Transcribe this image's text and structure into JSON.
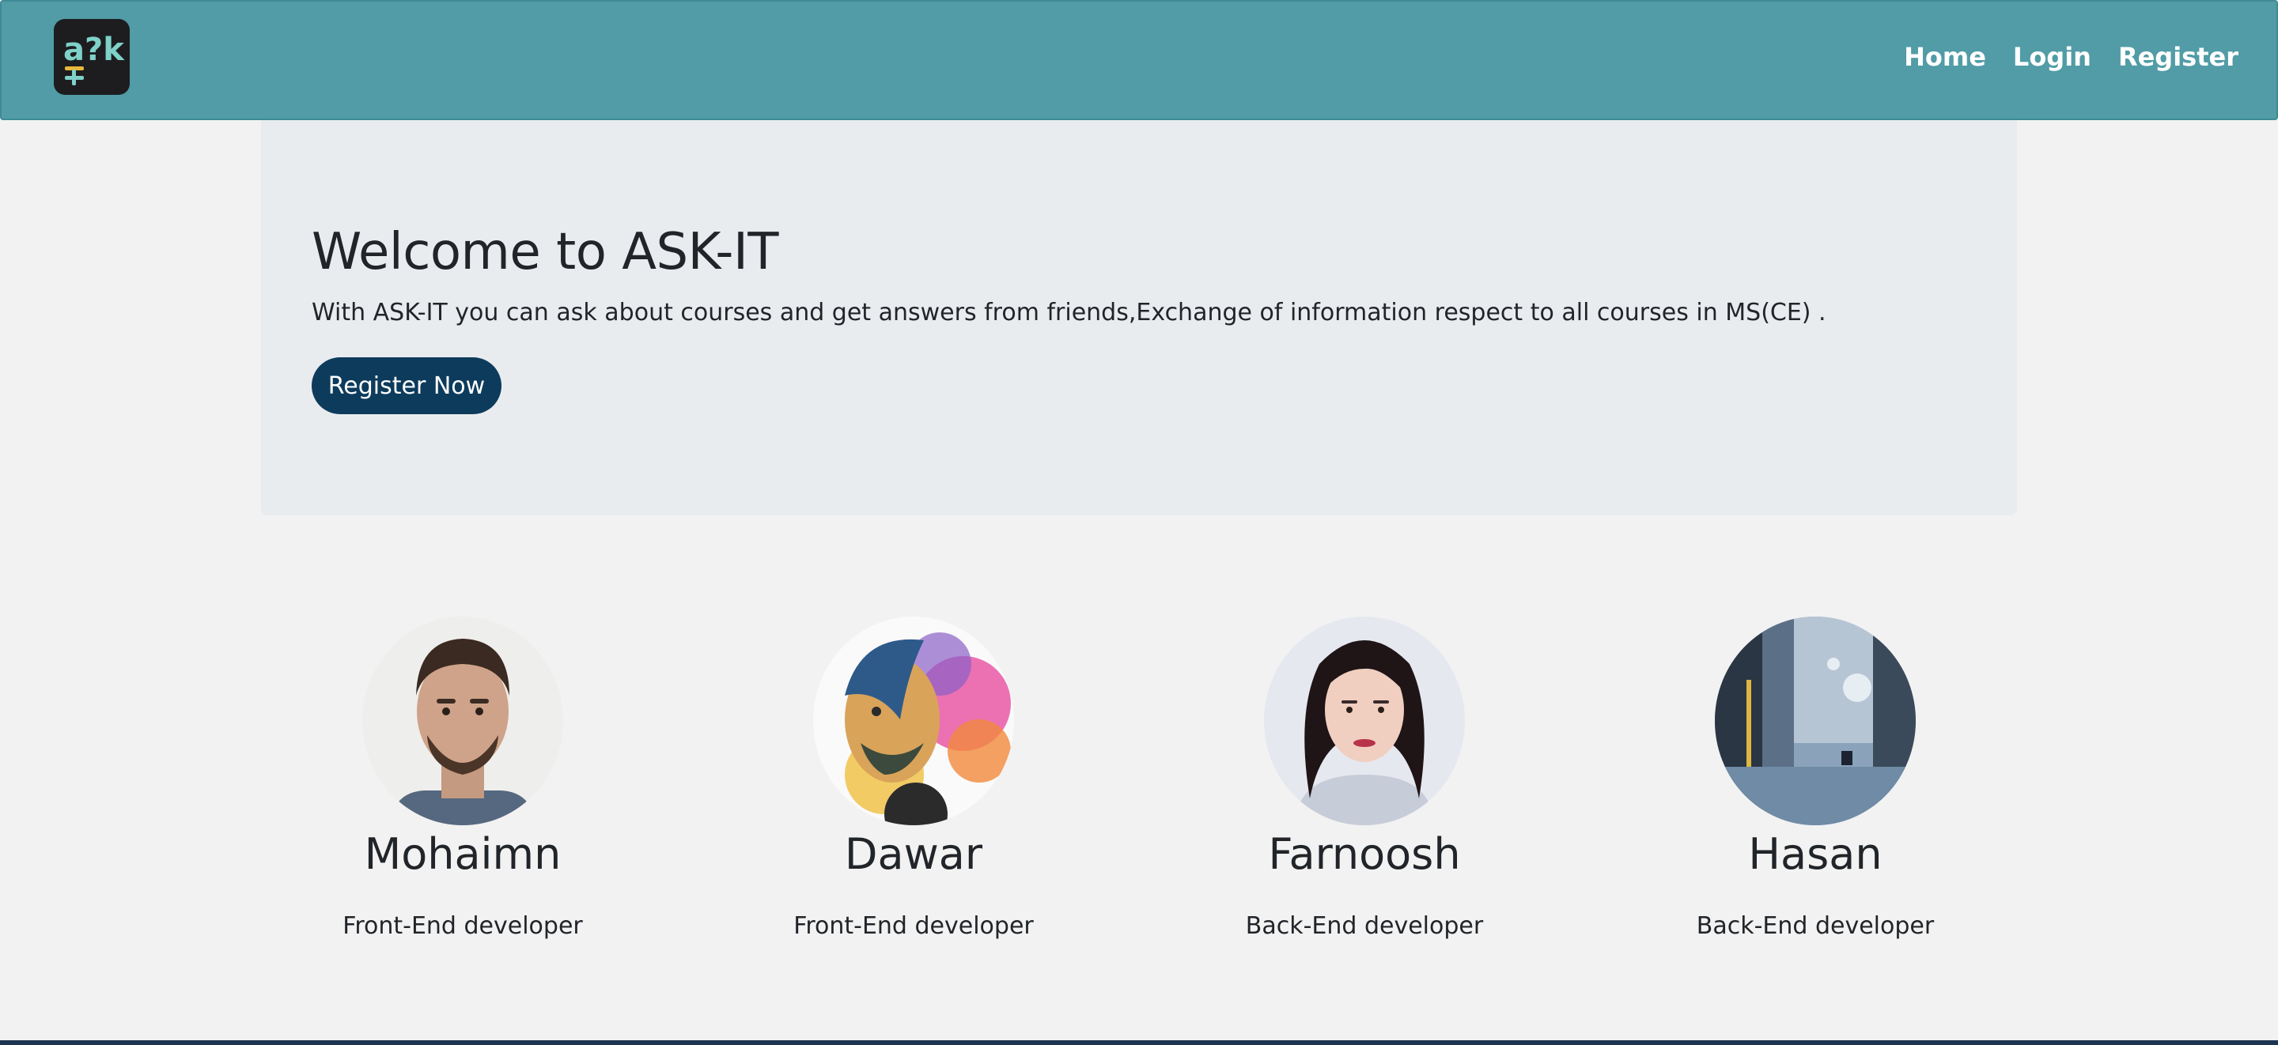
{
  "nav": {
    "logo_text": "a?k",
    "links": [
      "Home",
      "Login",
      "Register"
    ]
  },
  "hero": {
    "title": "Welcome to ASK-IT",
    "text": "With ASK-IT you can ask about courses and get answers from friends,Exchange of information respect to all courses in MS(CE) .",
    "button_label": "Register Now"
  },
  "team": [
    {
      "name": "Mohaimn",
      "role": "Front-End developer"
    },
    {
      "name": "Dawar",
      "role": "Front-End developer"
    },
    {
      "name": "Farnoosh",
      "role": "Back-End developer"
    },
    {
      "name": "Hasan",
      "role": "Back-End developer"
    }
  ],
  "colors": {
    "navbar": "#519ca6",
    "jumbotron": "#e9ecef",
    "button": "#0d3b5c",
    "page": "#f2f2f2"
  }
}
